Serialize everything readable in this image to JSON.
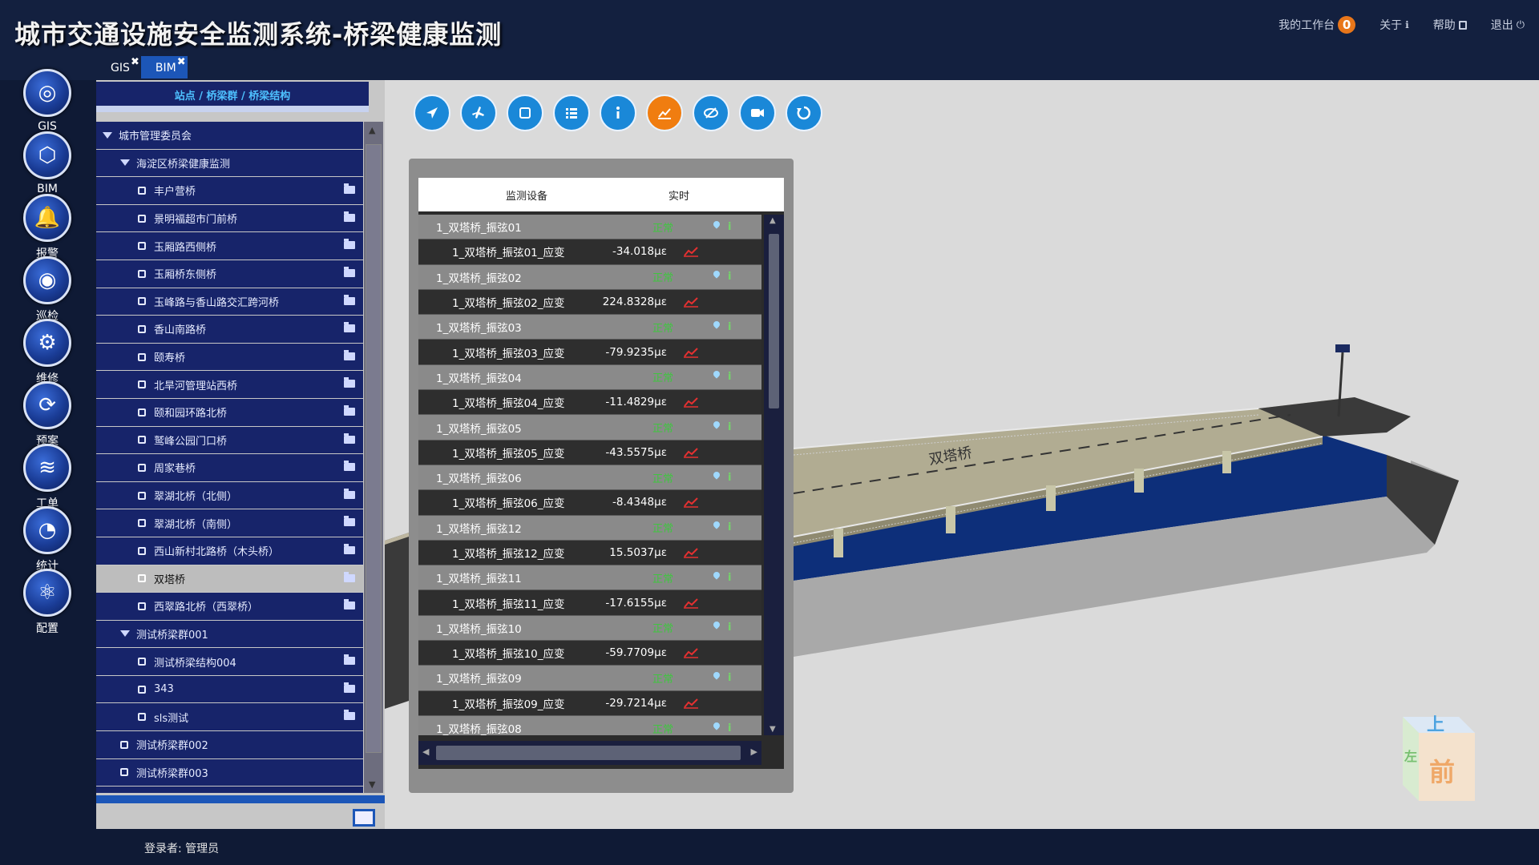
{
  "header": {
    "title": "城市交通设施安全监测系统-桥梁健康监测",
    "menu": {
      "workbench": "我的工作台",
      "workbench_count": "0",
      "about": "关于",
      "help": "帮助",
      "logout": "退出"
    }
  },
  "nav": {
    "items": [
      {
        "label": "GIS",
        "icon": "globe-icon"
      },
      {
        "label": "BIM",
        "icon": "cube-icon"
      },
      {
        "label": "报警",
        "icon": "bell-icon"
      },
      {
        "label": "巡检",
        "icon": "eye-icon"
      },
      {
        "label": "维修",
        "icon": "gear-wrench-icon"
      },
      {
        "label": "预案",
        "icon": "refresh-icon"
      },
      {
        "label": "工单",
        "icon": "layers-icon"
      },
      {
        "label": "统计",
        "icon": "gauge-icon"
      },
      {
        "label": "配置",
        "icon": "atom-icon"
      }
    ]
  },
  "tabs": [
    {
      "label": "GIS",
      "active": false
    },
    {
      "label": "BIM",
      "active": true
    }
  ],
  "tree": {
    "breadcrumb": "站点 / 桥梁群 / 桥梁结构",
    "rows": [
      {
        "label": "城市管理委员会",
        "level": 0,
        "type": "caret"
      },
      {
        "label": "海淀区桥梁健康监测",
        "level": 1,
        "type": "caret"
      },
      {
        "label": "丰户营桥",
        "level": 2,
        "type": "leaf"
      },
      {
        "label": "景明福超市门前桥",
        "level": 2,
        "type": "leaf"
      },
      {
        "label": "玉厢路西侧桥",
        "level": 2,
        "type": "leaf"
      },
      {
        "label": "玉厢桥东侧桥",
        "level": 2,
        "type": "leaf"
      },
      {
        "label": "玉峰路与香山路交汇跨河桥",
        "level": 2,
        "type": "leaf"
      },
      {
        "label": "香山南路桥",
        "level": 2,
        "type": "leaf"
      },
      {
        "label": "颐寿桥",
        "level": 2,
        "type": "leaf"
      },
      {
        "label": "北旱河管理站西桥",
        "level": 2,
        "type": "leaf"
      },
      {
        "label": "颐和园环路北桥",
        "level": 2,
        "type": "leaf"
      },
      {
        "label": "鹫峰公园门口桥",
        "level": 2,
        "type": "leaf"
      },
      {
        "label": "周家巷桥",
        "level": 2,
        "type": "leaf"
      },
      {
        "label": "翠湖北桥（北侧）",
        "level": 2,
        "type": "leaf"
      },
      {
        "label": "翠湖北桥（南侧）",
        "level": 2,
        "type": "leaf"
      },
      {
        "label": "西山新村北路桥（木头桥）",
        "level": 2,
        "type": "leaf"
      },
      {
        "label": "双塔桥",
        "level": 2,
        "type": "leaf",
        "selected": true
      },
      {
        "label": "西翠路北桥（西翠桥）",
        "level": 2,
        "type": "leaf"
      },
      {
        "label": "测试桥梁群001",
        "level": 1,
        "type": "caret"
      },
      {
        "label": "测试桥梁结构004",
        "level": 2,
        "type": "leaf"
      },
      {
        "label": "343",
        "level": 2,
        "type": "leaf"
      },
      {
        "label": "sls测试",
        "level": 2,
        "type": "leaf"
      },
      {
        "label": "测试桥梁群002",
        "level": 1,
        "type": "box"
      },
      {
        "label": "测试桥梁群003",
        "level": 1,
        "type": "box"
      }
    ]
  },
  "toolbar": {
    "buttons": [
      "locate-icon",
      "plane-icon",
      "square-icon",
      "list-icon",
      "info-icon",
      "chart-icon",
      "eye-slash-icon",
      "video-icon",
      "refresh-icon"
    ],
    "active": "chart-icon"
  },
  "monitor": {
    "col_device": "监测设备",
    "col_realtime": "实时",
    "rows": [
      {
        "type": "dev",
        "name": "1_双塔桥_振弦01",
        "status": "正常"
      },
      {
        "type": "sub",
        "name": "1_双塔桥_振弦01_应变",
        "value": "-34.018με"
      },
      {
        "type": "dev",
        "name": "1_双塔桥_振弦02",
        "status": "正常"
      },
      {
        "type": "sub",
        "name": "1_双塔桥_振弦02_应变",
        "value": "224.8328με"
      },
      {
        "type": "dev",
        "name": "1_双塔桥_振弦03",
        "status": "正常"
      },
      {
        "type": "sub",
        "name": "1_双塔桥_振弦03_应变",
        "value": "-79.9235με"
      },
      {
        "type": "dev",
        "name": "1_双塔桥_振弦04",
        "status": "正常"
      },
      {
        "type": "sub",
        "name": "1_双塔桥_振弦04_应变",
        "value": "-11.4829με"
      },
      {
        "type": "dev",
        "name": "1_双塔桥_振弦05",
        "status": "正常"
      },
      {
        "type": "sub",
        "name": "1_双塔桥_振弦05_应变",
        "value": "-43.5575με"
      },
      {
        "type": "dev",
        "name": "1_双塔桥_振弦06",
        "status": "正常"
      },
      {
        "type": "sub",
        "name": "1_双塔桥_振弦06_应变",
        "value": "-8.4348με"
      },
      {
        "type": "dev",
        "name": "1_双塔桥_振弦12",
        "status": "正常"
      },
      {
        "type": "sub",
        "name": "1_双塔桥_振弦12_应变",
        "value": "15.5037με"
      },
      {
        "type": "dev",
        "name": "1_双塔桥_振弦11",
        "status": "正常"
      },
      {
        "type": "sub",
        "name": "1_双塔桥_振弦11_应变",
        "value": "-17.6155με"
      },
      {
        "type": "dev",
        "name": "1_双塔桥_振弦10",
        "status": "正常"
      },
      {
        "type": "sub",
        "name": "1_双塔桥_振弦10_应变",
        "value": "-59.7709με"
      },
      {
        "type": "dev",
        "name": "1_双塔桥_振弦09",
        "status": "正常"
      },
      {
        "type": "sub",
        "name": "1_双塔桥_振弦09_应变",
        "value": "-29.7214με"
      },
      {
        "type": "dev",
        "name": "1_双塔桥_振弦08",
        "status": "正常"
      }
    ]
  },
  "scene": {
    "bridge_label": "双塔桥",
    "viewcube_top": "上",
    "viewcube_front": "前",
    "viewcube_side": "左"
  },
  "footer": {
    "login": "登录者: 管理员"
  }
}
